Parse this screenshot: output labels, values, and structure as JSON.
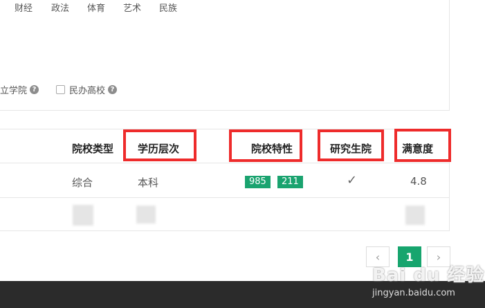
{
  "filters": {
    "categories": [
      "财经",
      "政法",
      "体育",
      "艺术",
      "民族"
    ],
    "options": [
      {
        "label": "立学院",
        "help": "?"
      },
      {
        "label": "民办高校",
        "help": "?"
      }
    ]
  },
  "table": {
    "headers": {
      "type": "院校类型",
      "level": "学历层次",
      "features": "院校特性",
      "grad_school": "研究生院",
      "satisfaction": "满意度"
    },
    "rows": [
      {
        "type": "综合",
        "level": "本科",
        "features": [
          "985",
          "211"
        ],
        "grad_school": "✓",
        "satisfaction": "4.8"
      }
    ]
  },
  "pagination": {
    "prev": "‹",
    "current": "1",
    "next": "›"
  },
  "colors": {
    "accent": "#1aa36f",
    "highlight": "#ee2b2b",
    "footer": "#2b2b2b"
  },
  "watermark": {
    "logo": "Bai du 经验",
    "url": "jingyan.baidu.com"
  }
}
